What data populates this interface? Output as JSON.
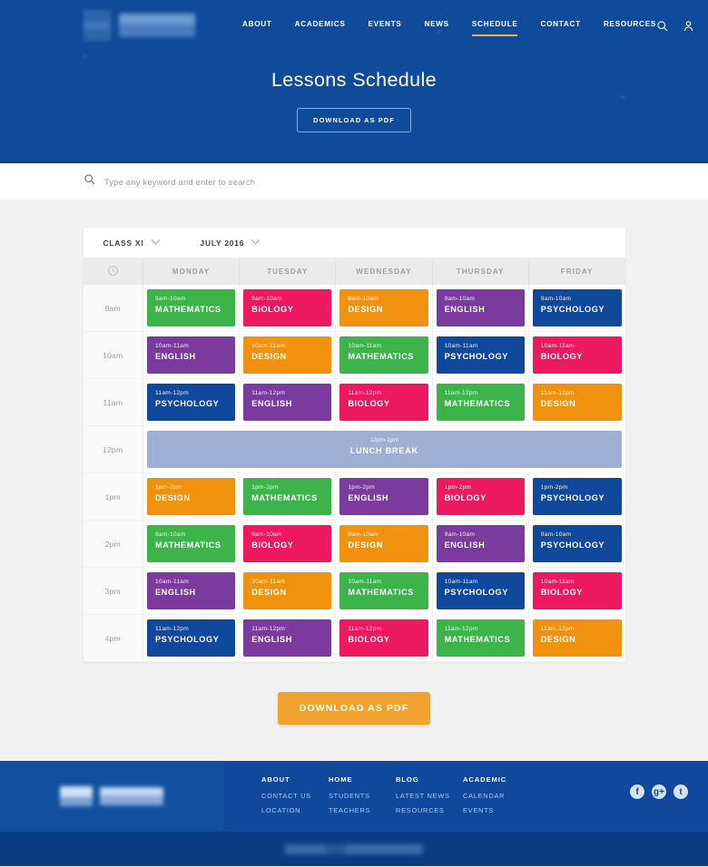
{
  "theme": {
    "brand_blue": "#104a9b",
    "dark_blue": "#0b3b80",
    "accent_orange": "#f0a32e",
    "nav_underline": "#eeb33b",
    "page_bg": "#f2f2f2"
  },
  "header": {
    "nav": [
      {
        "label": "ABOUT",
        "active": false
      },
      {
        "label": "ACADEMICS",
        "active": false
      },
      {
        "label": "EVENTS",
        "active": false
      },
      {
        "label": "NEWS",
        "active": false
      },
      {
        "label": "SCHEDULE",
        "active": true
      },
      {
        "label": "CONTACT",
        "active": false
      },
      {
        "label": "RESOURCES",
        "active": false
      }
    ],
    "icons": [
      "search-icon",
      "user-icon"
    ]
  },
  "hero": {
    "title": "Lessons Schedule",
    "button_label": "DOWNLOAD AS PDF"
  },
  "search": {
    "placeholder": "Type any keyword and enter to search",
    "value": "",
    "icon": "search-icon"
  },
  "filters": {
    "class": {
      "label": "CLASS XI",
      "icon": "chevron-down-icon"
    },
    "month": {
      "label": "JULY 2016",
      "icon": "chevron-down-icon"
    }
  },
  "schedule": {
    "corner_icon": "clock-icon",
    "days": [
      "MONDAY",
      "TUESDAY",
      "WEDNESDAY",
      "THURSDAY",
      "FRIDAY"
    ],
    "subject_colors": {
      "MATHEMATICS": "#3cb44a",
      "BIOLOGY": "#ec1961",
      "DESIGN": "#f0920e",
      "ENGLISH": "#7a3a9e",
      "PSYCHOLOGY": "#10489c",
      "LUNCH BREAK": "#9fafd4"
    },
    "rows": [
      {
        "time_label": "9am",
        "type": "lessons",
        "cells": [
          {
            "time": "9am-10am",
            "subject": "MATHEMATICS",
            "color": "#3cb44a"
          },
          {
            "time": "9am-10am",
            "subject": "BIOLOGY",
            "color": "#ec1961"
          },
          {
            "time": "9am-10am",
            "subject": "DESIGN",
            "color": "#f0920e"
          },
          {
            "time": "9am-10am",
            "subject": "ENGLISH",
            "color": "#7a3a9e"
          },
          {
            "time": "9am-10am",
            "subject": "PSYCHOLOGY",
            "color": "#10489c"
          }
        ]
      },
      {
        "time_label": "10am",
        "type": "lessons",
        "cells": [
          {
            "time": "10am-11am",
            "subject": "ENGLISH",
            "color": "#7a3a9e"
          },
          {
            "time": "10am-11am",
            "subject": "DESIGN",
            "color": "#f0920e"
          },
          {
            "time": "10am-11am",
            "subject": "MATHEMATICS",
            "color": "#3cb44a"
          },
          {
            "time": "10am-11am",
            "subject": "PSYCHOLOGY",
            "color": "#10489c"
          },
          {
            "time": "10am-11am",
            "subject": "BIOLOGY",
            "color": "#ec1961"
          }
        ]
      },
      {
        "time_label": "11am",
        "type": "lessons",
        "cells": [
          {
            "time": "11am-12pm",
            "subject": "PSYCHOLOGY",
            "color": "#10489c"
          },
          {
            "time": "11am-12pm",
            "subject": "ENGLISH",
            "color": "#7a3a9e"
          },
          {
            "time": "11am-12pm",
            "subject": "BIOLOGY",
            "color": "#ec1961"
          },
          {
            "time": "11am-12pm",
            "subject": "MATHEMATICS",
            "color": "#3cb44a"
          },
          {
            "time": "11am-12pm",
            "subject": "DESIGN",
            "color": "#f0920e"
          }
        ]
      },
      {
        "time_label": "12pm",
        "type": "break",
        "break": {
          "time": "12pm-1pm",
          "subject": "LUNCH BREAK",
          "color": "#9fafd4",
          "span": 5
        }
      },
      {
        "time_label": "1pm",
        "type": "lessons",
        "cells": [
          {
            "time": "1pm-2pm",
            "subject": "DESIGN",
            "color": "#f0920e"
          },
          {
            "time": "1pm-2pm",
            "subject": "MATHEMATICS",
            "color": "#3cb44a"
          },
          {
            "time": "1pm-2pm",
            "subject": "ENGLISH",
            "color": "#7a3a9e"
          },
          {
            "time": "1pm-2pm",
            "subject": "BIOLOGY",
            "color": "#ec1961"
          },
          {
            "time": "1pm-2pm",
            "subject": "PSYCHOLOGY",
            "color": "#10489c"
          }
        ]
      },
      {
        "time_label": "2pm",
        "type": "lessons",
        "cells": [
          {
            "time": "9am-10am",
            "subject": "MATHEMATICS",
            "color": "#3cb44a"
          },
          {
            "time": "9am-10am",
            "subject": "BIOLOGY",
            "color": "#ec1961"
          },
          {
            "time": "9am-10am",
            "subject": "DESIGN",
            "color": "#f0920e"
          },
          {
            "time": "9am-10am",
            "subject": "ENGLISH",
            "color": "#7a3a9e"
          },
          {
            "time": "9am-10am",
            "subject": "PSYCHOLOGY",
            "color": "#10489c"
          }
        ]
      },
      {
        "time_label": "3pm",
        "type": "lessons",
        "cells": [
          {
            "time": "10am-11am",
            "subject": "ENGLISH",
            "color": "#7a3a9e"
          },
          {
            "time": "10am-11am",
            "subject": "DESIGN",
            "color": "#f0920e"
          },
          {
            "time": "10am-11am",
            "subject": "MATHEMATICS",
            "color": "#3cb44a"
          },
          {
            "time": "10am-11am",
            "subject": "PSYCHOLOGY",
            "color": "#10489c"
          },
          {
            "time": "10am-11am",
            "subject": "BIOLOGY",
            "color": "#ec1961"
          }
        ]
      },
      {
        "time_label": "4pm",
        "type": "lessons",
        "cells": [
          {
            "time": "11am-12pm",
            "subject": "PSYCHOLOGY",
            "color": "#10489c"
          },
          {
            "time": "11am-12pm",
            "subject": "ENGLISH",
            "color": "#7a3a9e"
          },
          {
            "time": "11am-12pm",
            "subject": "BIOLOGY",
            "color": "#ec1961"
          },
          {
            "time": "11am-12pm",
            "subject": "MATHEMATICS",
            "color": "#3cb44a"
          },
          {
            "time": "11am-12pm",
            "subject": "DESIGN",
            "color": "#f0920e"
          }
        ]
      }
    ]
  },
  "main": {
    "download_button": "DOWNLOAD AS PDF"
  },
  "footer": {
    "columns": [
      {
        "title": "ABOUT",
        "links": [
          "CONTACT US",
          "LOCATION"
        ]
      },
      {
        "title": "HOME",
        "links": [
          "STUDENTS",
          "TEACHERS"
        ]
      },
      {
        "title": "BLOG",
        "links": [
          "LATEST NEWS",
          "RESOURCES"
        ]
      },
      {
        "title": "ACADEMIC",
        "links": [
          "CALENDAR",
          "EVENTS"
        ]
      }
    ],
    "socials": [
      {
        "name": "facebook-icon",
        "glyph": "f"
      },
      {
        "name": "google-plus-icon",
        "glyph": "g+"
      },
      {
        "name": "twitter-icon",
        "glyph": "t"
      }
    ]
  }
}
